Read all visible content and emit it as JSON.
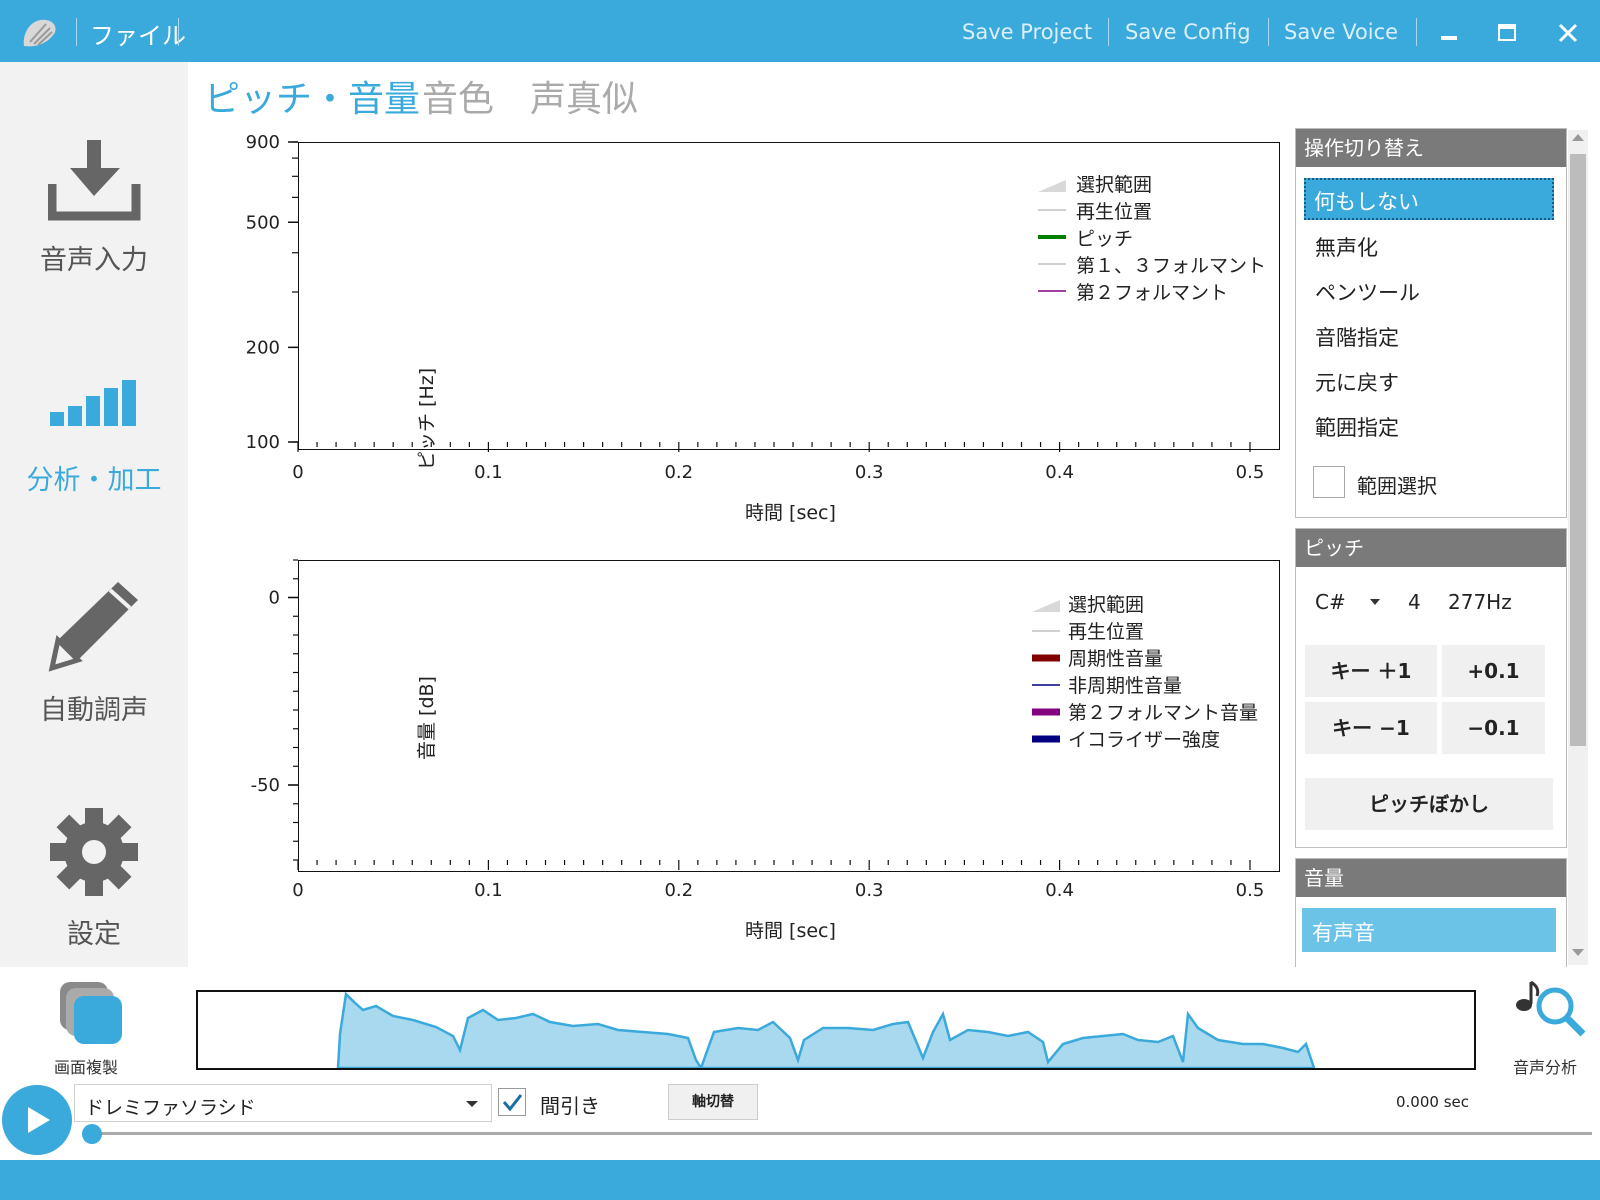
{
  "titlebar": {
    "file_menu": "ファイル",
    "save_project": "Save Project",
    "save_config": "Save Config",
    "save_voice": "Save Voice"
  },
  "nav": [
    {
      "label": "音声入力",
      "icon": "download-icon"
    },
    {
      "label": "分析・加工",
      "icon": "signal-bars-icon",
      "active": true
    },
    {
      "label": "自動調声",
      "icon": "pencil-icon"
    },
    {
      "label": "設定",
      "icon": "gear-icon"
    }
  ],
  "tabs": [
    {
      "label": "ピッチ・音量",
      "active": true
    },
    {
      "label": "音色"
    },
    {
      "label": "声真似"
    }
  ],
  "colors": {
    "accent": "#3aa9db",
    "pitch": "#008000",
    "formant2": "#800080",
    "periodic": "#800000",
    "aperiodic": "#000080",
    "formant2vol": "#800080",
    "eq": "#000080"
  },
  "chart_data": [
    {
      "type": "line",
      "xlabel": "時間 [sec]",
      "ylabel": "ピッチ [Hz]",
      "xlim": [
        0,
        0.5
      ],
      "ylim": [
        100,
        900
      ],
      "yscale": "log",
      "x_ticks": [
        "0",
        "0.1",
        "0.2",
        "0.3",
        "0.4",
        "0.5"
      ],
      "y_ticks": [
        "900",
        "500",
        "200",
        "100"
      ],
      "legend_position": "top-right",
      "series": [
        {
          "name": "選択範囲",
          "values": []
        },
        {
          "name": "再生位置",
          "values": []
        },
        {
          "name": "ピッチ",
          "values": []
        },
        {
          "name": "第１、３フォルマント",
          "values": []
        },
        {
          "name": "第２フォルマント",
          "values": []
        }
      ]
    },
    {
      "type": "line",
      "xlabel": "時間 [sec]",
      "ylabel": "音量 [dB]",
      "xlim": [
        0,
        0.5
      ],
      "ylim": [
        -70,
        10
      ],
      "x_ticks": [
        "0",
        "0.1",
        "0.2",
        "0.3",
        "0.4",
        "0.5"
      ],
      "y_ticks": [
        "0",
        "-50"
      ],
      "legend_position": "top-right",
      "series": [
        {
          "name": "選択範囲",
          "values": []
        },
        {
          "name": "再生位置",
          "values": []
        },
        {
          "name": "周期性音量",
          "values": []
        },
        {
          "name": "非周期性音量",
          "values": []
        },
        {
          "name": "第２フォルマント音量",
          "values": []
        },
        {
          "name": "イコライザー強度",
          "values": []
        }
      ]
    }
  ],
  "panel_ops": {
    "header": "操作切り替え",
    "items": [
      "何もしない",
      "無声化",
      "ペンツール",
      "音階指定",
      "元に戻す",
      "範囲指定"
    ],
    "selected": "何もしない",
    "range_select_label": "範囲選択",
    "range_select_checked": false
  },
  "panel_pitch": {
    "header": "ピッチ",
    "note": "C#",
    "octave": "4",
    "freq": "277Hz",
    "key_up": "キー ＋1",
    "fine_up": "+0.1",
    "key_down": "キー −1",
    "fine_down": "−0.1",
    "blur": "ピッチぼかし"
  },
  "panel_volume": {
    "header": "音量",
    "selected": "有声音"
  },
  "bottom": {
    "screen_copy_label": "画面複製",
    "analysis_label": "音声分析",
    "preset": "ドレミファソラシド",
    "thinning_label": "間引き",
    "thinning_checked": true,
    "axis_lock_label": "軸切替",
    "time": "0.000 sec",
    "playback_position": 0
  }
}
